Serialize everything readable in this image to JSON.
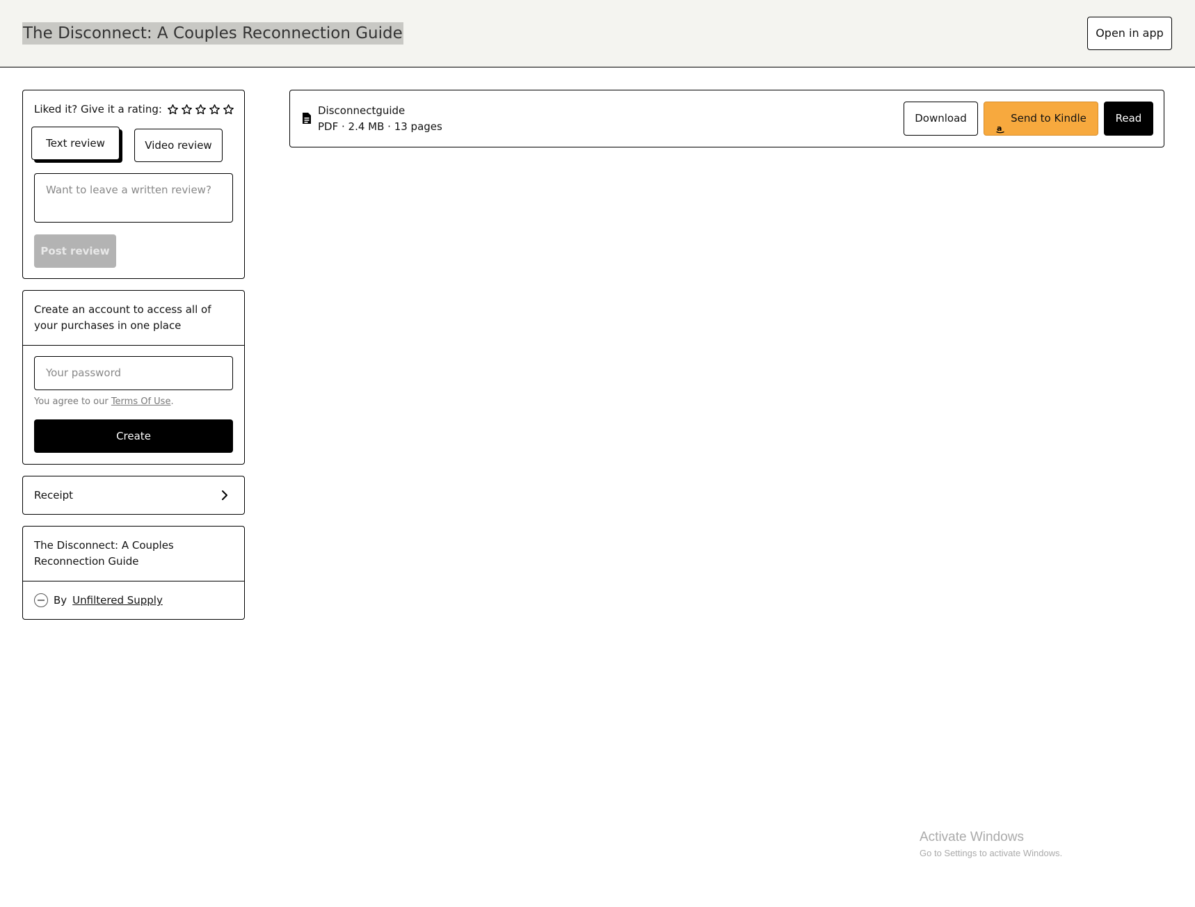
{
  "header": {
    "title": "The Disconnect: A Couples Reconnection Guide",
    "open_in_app": "Open in app"
  },
  "review": {
    "rating_prompt": "Liked it? Give it a rating:",
    "stars": 5,
    "tab_text": "Text review",
    "tab_video": "Video review",
    "placeholder": "Want to leave a written review?",
    "post_label": "Post review"
  },
  "account": {
    "message": "Create an account to access all of your purchases in one place",
    "password_placeholder": "Your password",
    "terms_prefix": "You agree to our ",
    "terms_link": "Terms Of Use",
    "terms_suffix": ".",
    "create_label": "Create"
  },
  "receipt": {
    "label": "Receipt"
  },
  "product": {
    "name": "The Disconnect: A Couples Reconnection Guide",
    "by_prefix": "By",
    "seller": "Unfiltered Supply"
  },
  "file": {
    "name": "Disconnectguide",
    "meta": "PDF · 2.4 MB · 13 pages",
    "download_label": "Download",
    "kindle_label": "Send to Kindle",
    "read_label": "Read"
  },
  "system": {
    "activate_title": "Activate Windows",
    "activate_sub": "Go to Settings to activate Windows."
  },
  "colors": {
    "kindle_orange": "#f7a93e",
    "header_bg": "#f4f4f0"
  }
}
